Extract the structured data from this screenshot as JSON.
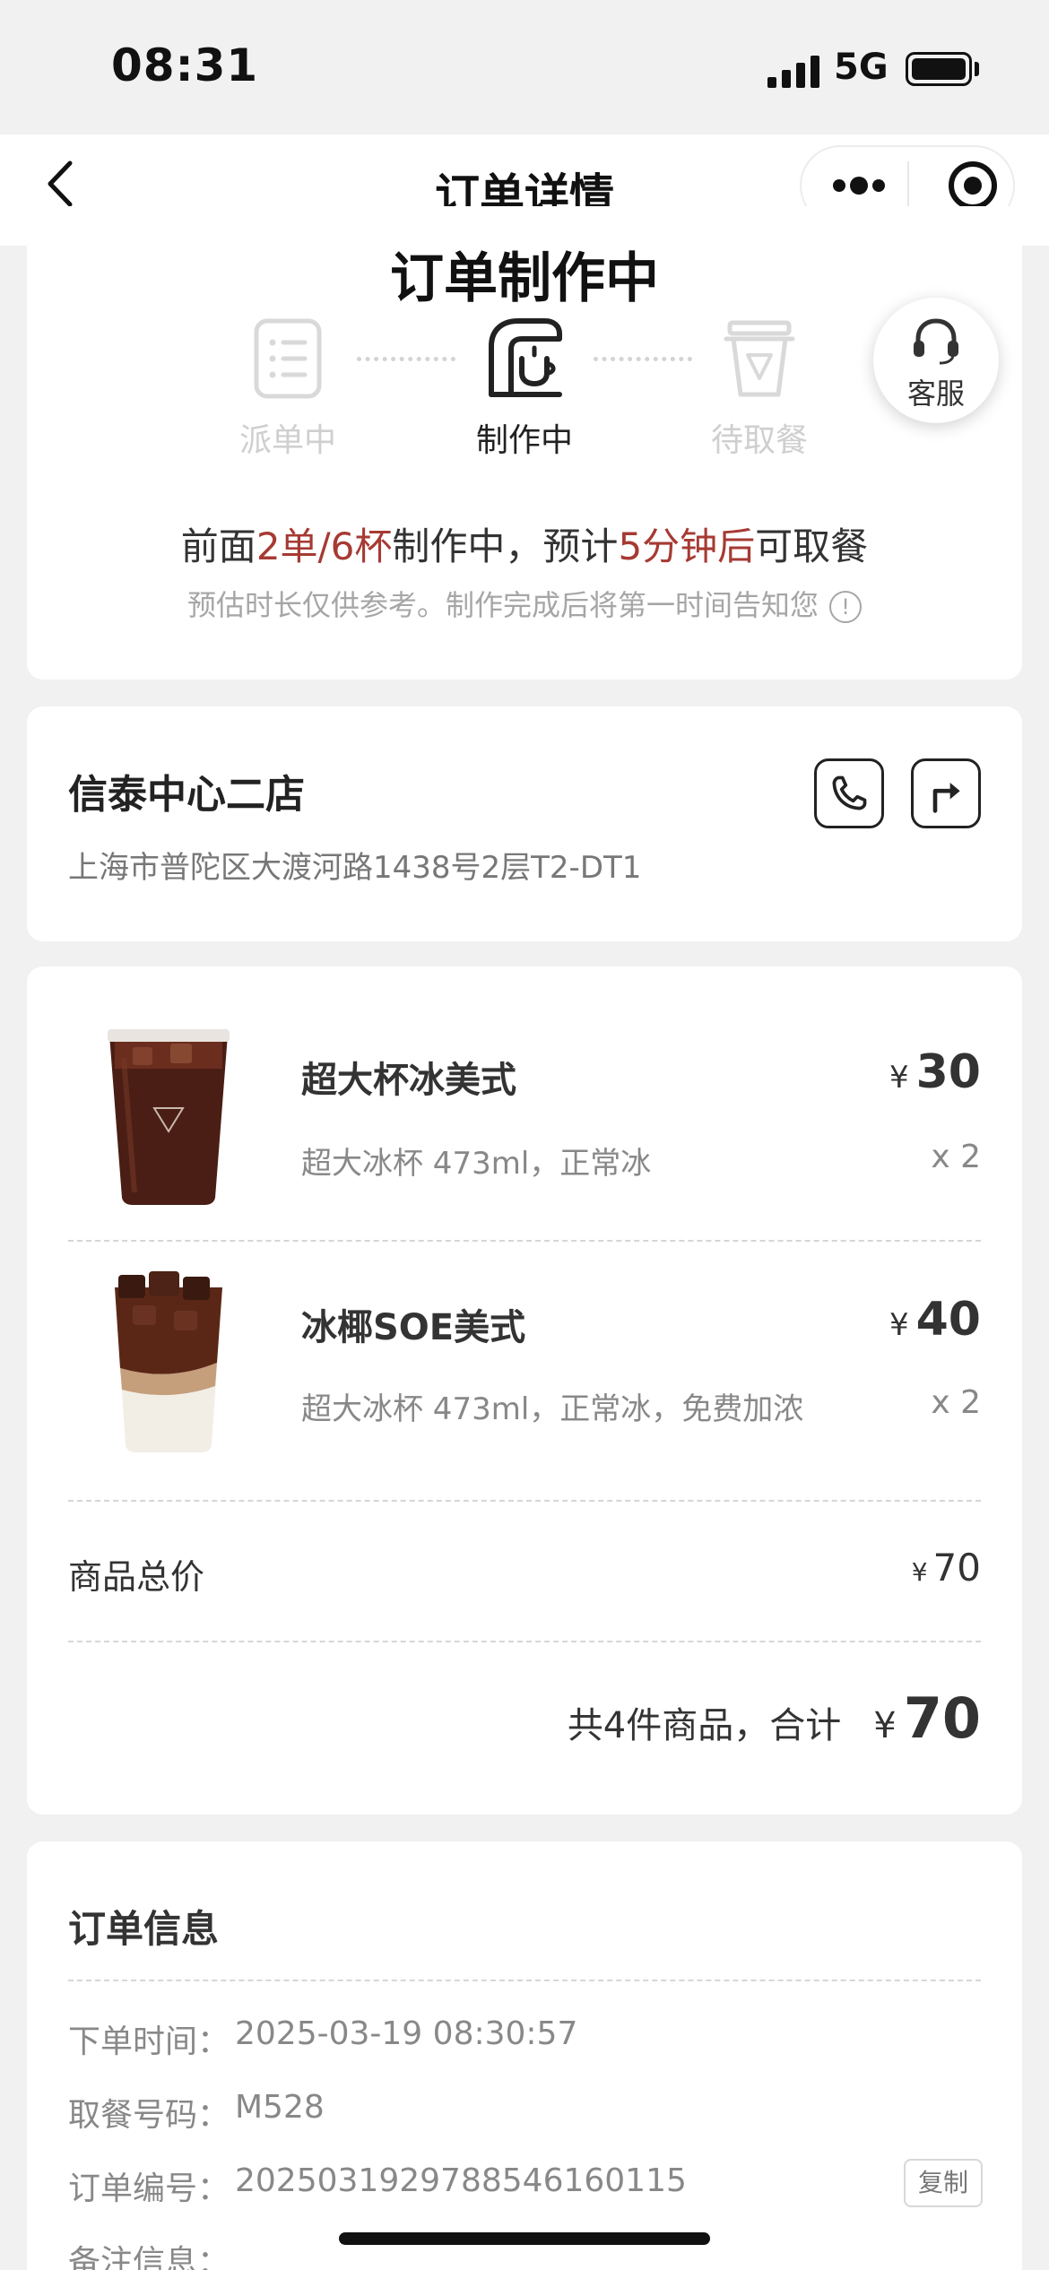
{
  "status_bar": {
    "time": "08:31",
    "network": "5G"
  },
  "nav": {
    "title": "订单详情"
  },
  "progress": {
    "title": "订单制作中",
    "steps": [
      {
        "label": "派单中",
        "state": "done"
      },
      {
        "label": "制作中",
        "state": "active"
      },
      {
        "label": "待取餐",
        "state": "pending"
      }
    ],
    "service_label": "客服",
    "queue": {
      "p1": "前面",
      "count": "2单/6杯",
      "p2": "制作中，预计",
      "eta": "5分钟后",
      "p3": "可取餐"
    },
    "hint": "预估时长仅供参考。制作完成后将第一时间告知您",
    "accent_color": "#a63a33"
  },
  "store": {
    "name": "信泰中心二店",
    "address": "上海市普陀区大渡河路1438号2层T2-DT1"
  },
  "items": [
    {
      "name": "超大杯冰美式",
      "spec": "超大冰杯 473ml，正常冰",
      "currency": "¥",
      "price": "30",
      "qty": "x 2"
    },
    {
      "name": "冰椰SOE美式",
      "spec": "超大冰杯 473ml，正常冰，免费加浓",
      "currency": "¥",
      "price": "40",
      "qty": "x 2"
    }
  ],
  "subtotal": {
    "label": "商品总价",
    "currency": "¥",
    "value": "70"
  },
  "total": {
    "label": "共4件商品，合计",
    "currency": "¥",
    "value": "70"
  },
  "order_info": {
    "title": "订单信息",
    "rows": [
      {
        "label": "下单时间：",
        "value": "2025-03-19 08:30:57"
      },
      {
        "label": "取餐号码：",
        "value": "M528"
      },
      {
        "label": "订单编号：",
        "value": "2025031929788546160115"
      },
      {
        "label": "备注信息：",
        "value": ""
      }
    ],
    "copy_label": "复制"
  }
}
